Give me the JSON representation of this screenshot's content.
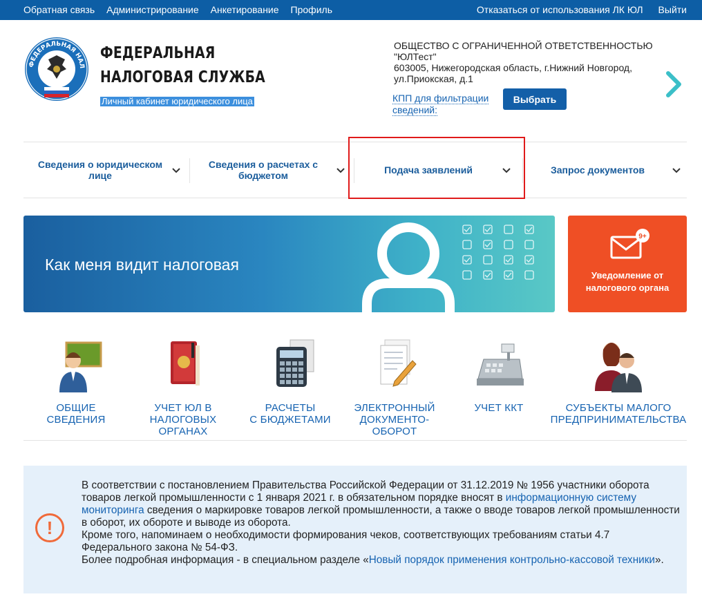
{
  "topbar": {
    "links": [
      "Обратная связь",
      "Администрирование",
      "Анкетирование",
      "Профиль"
    ],
    "right_links": [
      "Отказаться от использования ЛК ЮЛ",
      "Выйти"
    ]
  },
  "header": {
    "brand_line1": "ФЕДЕРАЛЬНАЯ",
    "brand_line2": "НАЛОГОВАЯ СЛУЖБА",
    "subtitle": "Личный кабинет юридического лица",
    "logo_text": "ФЕДЕРАЛЬНАЯ НАЛОГОВАЯ СЛУЖБА",
    "org_lines": [
      "ОБЩЕСТВО С ОГРАНИЧЕННОЙ ОТВЕТСТВЕННОСТЬЮ",
      "\"ЮЛТест\"",
      "603005, Нижегородская область, г.Нижний Новгород,",
      "ул.Приокская, д.1"
    ],
    "kpp_label": "КПП для фильтрации сведений:",
    "select_button": "Выбрать"
  },
  "nav": {
    "items": [
      {
        "label": "Сведения о юридическом лице"
      },
      {
        "label": "Сведения о расчетах с бюджетом"
      },
      {
        "label": "Подача заявлений"
      },
      {
        "label": "Запрос документов"
      }
    ]
  },
  "banner": {
    "title": "Как меня видит налоговая"
  },
  "notification": {
    "badge": "9+",
    "text": "Уведомление от налогового органа"
  },
  "tiles": [
    {
      "label": "ОБЩИЕ\nСВЕДЕНИЯ",
      "icon": "teacher-icon"
    },
    {
      "label": "УЧЕТ ЮЛ В\nНАЛОГОВЫХ\nОРГАНАХ",
      "icon": "red-book-icon"
    },
    {
      "label": "РАСЧЕТЫ\nС БЮДЖЕТАМИ",
      "icon": "calculator-icon"
    },
    {
      "label": "ЭЛЕКТРОННЫЙ\nДОКУМЕНТО-\nОБОРОТ",
      "icon": "document-pen-icon"
    },
    {
      "label": "УЧЕТ ККТ",
      "icon": "cash-register-icon"
    },
    {
      "label": "СУБЪЕКТЫ МАЛОГО\nПРЕДПРИНИМАТЕЛЬСТВА",
      "icon": "business-people-icon"
    }
  ],
  "info": {
    "p1_a": "В соответствии с постановлением Правительства Российской Федерации от 31.12.2019 № 1956 участники оборота товаров легкой промышленности с 1 января 2021 г. в обязательном порядке вносят в ",
    "p1_link": "информационную систему мониторинга",
    "p1_b": " сведения о маркировке товаров легкой промышленности, а также о вводе товаров легкой промышленности в оборот, их обороте и выводе из оборота.",
    "p2": "Кроме того, напоминаем о необходимости формирования чеков, соответствующих требованиям статьи 4.7 Федерального закона № 54-ФЗ.",
    "p3_a": "Более подробная информация - в специальном разделе «",
    "p3_link": "Новый порядок применения контрольно-кассовой техники",
    "p3_b": "».",
    "icon_glyph": "!"
  },
  "colors": {
    "topbar": "#0d5ea5",
    "accent_link": "#1663b1",
    "notify": "#ef4f25",
    "highlight": "#e01a1a"
  }
}
